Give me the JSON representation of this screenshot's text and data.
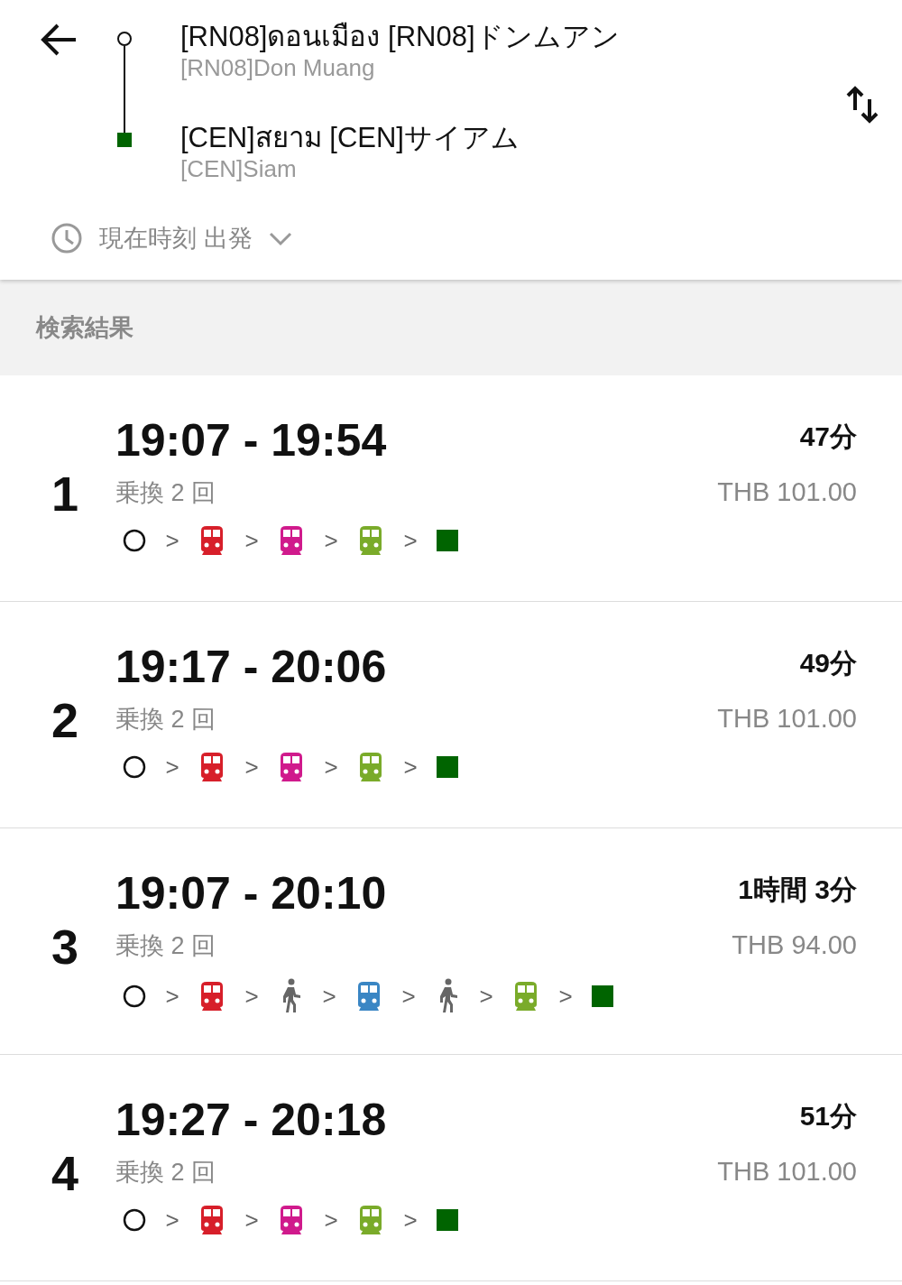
{
  "header": {
    "origin": {
      "name": "[RN08]ดอนเมือง [RN08]ドンムアン",
      "sub": "[RN08]Don Muang"
    },
    "destination": {
      "name": "[CEN]สยาม [CEN]サイアム",
      "sub": "[CEN]Siam"
    },
    "departure": "現在時刻 出発"
  },
  "section_title": "検索結果",
  "routes": [
    {
      "number": "1",
      "times": "19:07 - 19:54",
      "transfers": "乗換 2 回",
      "duration": "47分",
      "fare": "THB 101.00",
      "legs": [
        {
          "kind": "origin"
        },
        {
          "kind": "sep",
          "text": ">"
        },
        {
          "kind": "train",
          "color": "#d71f2a"
        },
        {
          "kind": "sep",
          "text": ">"
        },
        {
          "kind": "train",
          "color": "#d01a8c"
        },
        {
          "kind": "sep",
          "text": ">"
        },
        {
          "kind": "train",
          "color": "#7aab2a"
        },
        {
          "kind": "sep",
          "text": ">"
        },
        {
          "kind": "destination"
        }
      ]
    },
    {
      "number": "2",
      "times": "19:17 - 20:06",
      "transfers": "乗換 2 回",
      "duration": "49分",
      "fare": "THB 101.00",
      "legs": [
        {
          "kind": "origin"
        },
        {
          "kind": "sep",
          "text": ">"
        },
        {
          "kind": "train",
          "color": "#d71f2a"
        },
        {
          "kind": "sep",
          "text": ">"
        },
        {
          "kind": "train",
          "color": "#d01a8c"
        },
        {
          "kind": "sep",
          "text": ">"
        },
        {
          "kind": "train",
          "color": "#7aab2a"
        },
        {
          "kind": "sep",
          "text": ">"
        },
        {
          "kind": "destination"
        }
      ]
    },
    {
      "number": "3",
      "times": "19:07 - 20:10",
      "transfers": "乗換 2 回",
      "duration": "1時間 3分",
      "fare": "THB 94.00",
      "legs": [
        {
          "kind": "origin"
        },
        {
          "kind": "sep",
          "text": ">"
        },
        {
          "kind": "train",
          "color": "#d71f2a"
        },
        {
          "kind": "sep",
          "text": ">"
        },
        {
          "kind": "walk"
        },
        {
          "kind": "sep",
          "text": ">"
        },
        {
          "kind": "train",
          "color": "#3a86c4"
        },
        {
          "kind": "sep",
          "text": ">"
        },
        {
          "kind": "walk"
        },
        {
          "kind": "sep",
          "text": ">"
        },
        {
          "kind": "train",
          "color": "#7aab2a"
        },
        {
          "kind": "sep",
          "text": ">"
        },
        {
          "kind": "destination"
        }
      ]
    },
    {
      "number": "4",
      "times": "19:27 - 20:18",
      "transfers": "乗換 2 回",
      "duration": "51分",
      "fare": "THB 101.00",
      "legs": [
        {
          "kind": "origin"
        },
        {
          "kind": "sep",
          "text": ">"
        },
        {
          "kind": "train",
          "color": "#d71f2a"
        },
        {
          "kind": "sep",
          "text": ">"
        },
        {
          "kind": "train",
          "color": "#d01a8c"
        },
        {
          "kind": "sep",
          "text": ">"
        },
        {
          "kind": "train",
          "color": "#7aab2a"
        },
        {
          "kind": "sep",
          "text": ">"
        },
        {
          "kind": "destination"
        }
      ]
    }
  ]
}
